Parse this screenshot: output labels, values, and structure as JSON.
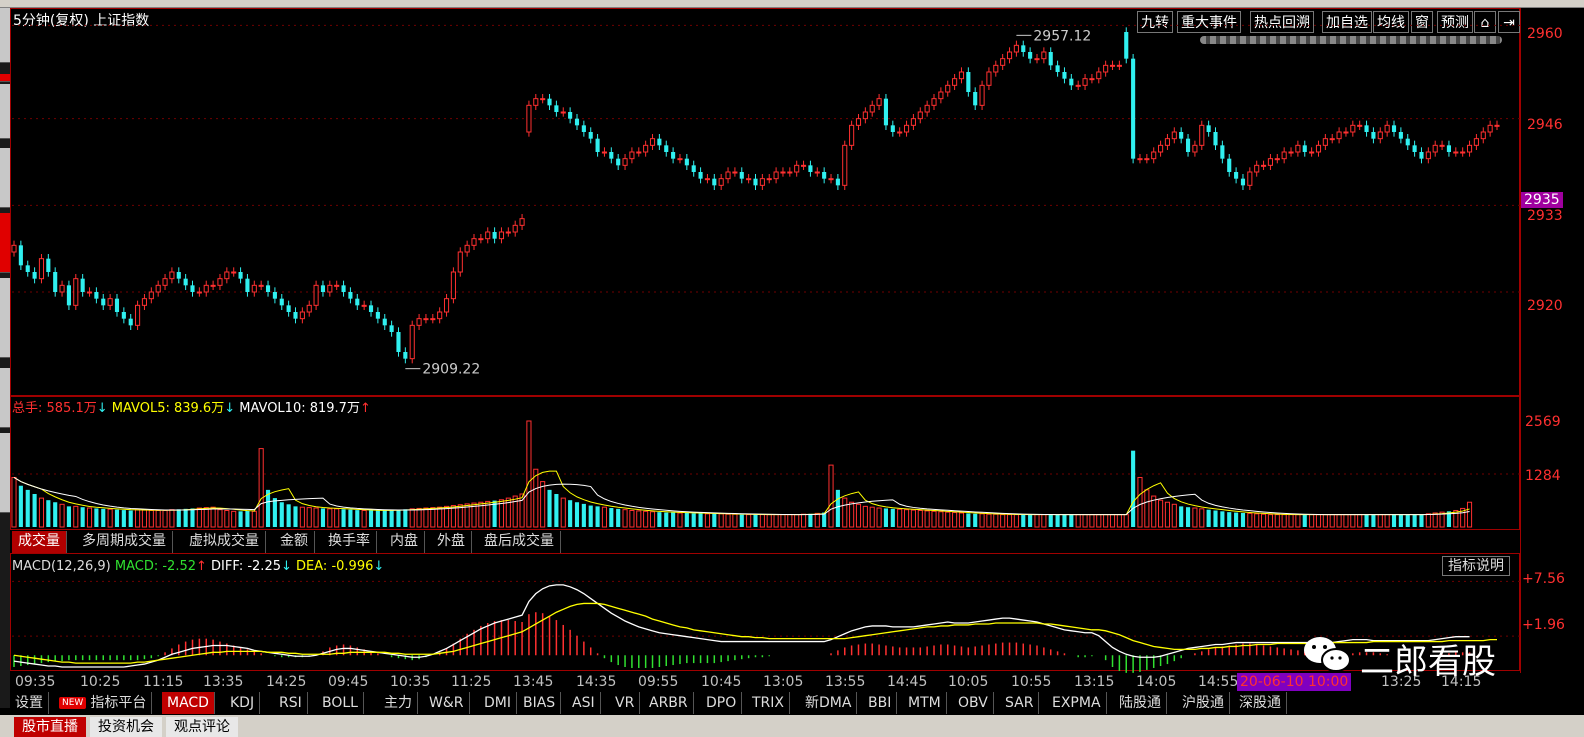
{
  "window": {
    "title": "5分钟(复权)",
    "index_name": "上证指数"
  },
  "toolbar": {
    "jiuzhuan": "九转",
    "major_events": "重大事件",
    "hotspot_trace": "热点回溯",
    "add_watch": "加自选",
    "ma_lines": "均线",
    "window": "窗",
    "forecast": "预测"
  },
  "colors": {
    "up": "#ff3030",
    "down": "#30f0f0",
    "ma5": "#ffff00",
    "ma10": "#ffffff",
    "axis": "#ff3030",
    "current_price_bg": "#a000a0"
  },
  "price_axis": {
    "labels": [
      "2960",
      "2946",
      "2933",
      "2920"
    ],
    "current": "2935"
  },
  "price_annotations": {
    "high": "2957.12",
    "low": "2909.22"
  },
  "volume_legend": {
    "total": "总手: 585.1万",
    "total_arrow": "↓",
    "mavol5": "MAVOL5: 839.6万",
    "mavol5_arrow": "↓",
    "mavol10": "MAVOL10: 819.7万",
    "mavol10_arrow": "↑"
  },
  "volume_axis": {
    "labels": [
      "2569",
      "1284"
    ]
  },
  "volume_tabs": [
    "成交量",
    "多周期成交量",
    "虚拟成交量",
    "金额",
    "换手率",
    "内盘",
    "外盘",
    "盘后成交量"
  ],
  "macd_legend": {
    "name": "MACD(12,26,9)",
    "macd": "MACD: -2.52",
    "macd_arrow": "↑",
    "diff": "DIFF: -2.25",
    "diff_arrow": "↓",
    "dea": "DEA: -0.996",
    "dea_arrow": "↓"
  },
  "macd_axis": {
    "labels": [
      "+7.56",
      "+1.96"
    ]
  },
  "indicator_help": "指标说明",
  "time_axis": [
    "09:35",
    "10:25",
    "11:15",
    "13:35",
    "14:25",
    "09:45",
    "10:35",
    "11:25",
    "13:45",
    "14:35",
    "09:55",
    "10:45",
    "13:05",
    "13:55",
    "14:45",
    "10:05",
    "10:55",
    "13:15",
    "14:05",
    "14:55",
    "13:25",
    "14:15"
  ],
  "time_cursor": "20-06-10 10:00",
  "indicator_tabs": {
    "settings": "设置",
    "new_badge": "NEW",
    "platform": "指标平台",
    "items": [
      "MACD",
      "KDJ",
      "RSI",
      "BOLL",
      "主力",
      "W&R",
      "DMI",
      "BIAS",
      "ASI",
      "VR",
      "ARBR",
      "DPO",
      "TRIX",
      "新DMA",
      "BBI",
      "MTM",
      "OBV",
      "SAR",
      "EXPMA",
      "陆股通",
      "沪股通",
      "深股通"
    ]
  },
  "bottom_tabs": [
    "股市直播",
    "投资机会",
    "观点评论"
  ],
  "watermark": "二郎看股",
  "chart_data": {
    "type": "candlestick",
    "ylim": [
      2905,
      2962
    ],
    "closes": [
      2927,
      2924,
      2923,
      2922,
      2925,
      2923,
      2920,
      2921,
      2918,
      2922,
      2920,
      2920,
      2919,
      2918,
      2919,
      2917,
      2916,
      2915,
      2918,
      2919,
      2920,
      2921,
      2922,
      2923,
      2922,
      2921,
      2920,
      2920,
      2921,
      2921,
      2922,
      2923,
      2923,
      2922,
      2920,
      2921,
      2921,
      2920,
      2919,
      2918,
      2917,
      2916,
      2917,
      2918,
      2921,
      2920,
      2921,
      2921,
      2920,
      2919,
      2918,
      2918,
      2917,
      2916,
      2915,
      2914,
      2911,
      2910,
      2915,
      2916,
      2916,
      2916,
      2917,
      2919,
      2923,
      2926,
      2927,
      2928,
      2928,
      2929,
      2928,
      2929,
      2929,
      2930,
      2931,
      2948,
      2949,
      2949,
      2948,
      2947,
      2947,
      2946,
      2945,
      2944,
      2943,
      2941,
      2941,
      2940,
      2939,
      2940,
      2941,
      2941,
      2942,
      2943,
      2942,
      2941,
      2940,
      2940,
      2939,
      2938,
      2937,
      2937,
      2936,
      2937,
      2938,
      2938,
      2937,
      2937,
      2936,
      2937,
      2937,
      2938,
      2938,
      2938,
      2939,
      2939,
      2938,
      2938,
      2937,
      2937,
      2936,
      2942,
      2945,
      2946,
      2947,
      2948,
      2949,
      2945,
      2944,
      2944,
      2945,
      2946,
      2947,
      2948,
      2949,
      2950,
      2951,
      2952,
      2953,
      2950,
      2948,
      2951,
      2953,
      2954,
      2955,
      2956,
      2957,
      2956,
      2955,
      2955,
      2956,
      2954,
      2953,
      2952,
      2951,
      2951,
      2952,
      2952,
      2953,
      2954,
      2954,
      2954,
      2955,
      2940,
      2940,
      2940,
      2941,
      2942,
      2943,
      2944,
      2943,
      2941,
      2942,
      2945,
      2944,
      2942,
      2940,
      2938,
      2937,
      2936,
      2938,
      2939,
      2939,
      2940,
      2940,
      2941,
      2941,
      2942,
      2941,
      2941,
      2942,
      2943,
      2943,
      2944,
      2944,
      2945,
      2945,
      2944,
      2943,
      2944,
      2945,
      2944,
      2943,
      2942,
      2941,
      2940,
      2941,
      2942,
      2942,
      2941,
      2941,
      2941,
      2942,
      2943,
      2944,
      2945,
      2945
    ],
    "volume_ylim": [
      0,
      2569
    ],
    "volumes": [
      1200,
      1000,
      900,
      800,
      700,
      650,
      600,
      550,
      500,
      500,
      480,
      460,
      450,
      440,
      430,
      420,
      410,
      400,
      420,
      410,
      400,
      400,
      400,
      420,
      430,
      440,
      450,
      460,
      470,
      480,
      420,
      400,
      380,
      380,
      400,
      380,
      1900,
      900,
      700,
      600,
      550,
      500,
      480,
      470,
      460,
      450,
      440,
      440,
      430,
      420,
      410,
      400,
      400,
      400,
      400,
      410,
      420,
      430,
      440,
      450,
      460,
      470,
      480,
      500,
      520,
      540,
      560,
      580,
      600,
      620,
      640,
      660,
      700,
      750,
      800,
      2569,
      1400,
      1100,
      900,
      800,
      700,
      650,
      600,
      560,
      520,
      500,
      480,
      460,
      440,
      420,
      400,
      390,
      380,
      370,
      360,
      350,
      350,
      340,
      340,
      330,
      330,
      320,
      320,
      320,
      310,
      310,
      300,
      300,
      300,
      300,
      300,
      300,
      300,
      300,
      300,
      310,
      320,
      330,
      350,
      1500,
      900,
      700,
      600,
      550,
      500,
      480,
      460,
      450,
      440,
      430,
      420,
      410,
      400,
      390,
      380,
      370,
      360,
      350,
      340,
      330,
      320,
      320,
      310,
      310,
      300,
      300,
      300,
      300,
      300,
      300,
      300,
      300,
      300,
      300,
      300,
      300,
      300,
      300,
      300,
      300,
      300,
      300,
      300,
      1850,
      1200,
      900,
      750,
      650,
      600,
      550,
      500,
      480,
      460,
      440,
      420,
      400,
      380,
      360,
      350,
      340,
      330,
      320,
      310,
      300,
      300,
      300,
      300,
      300,
      300,
      300,
      300,
      300,
      300,
      300,
      300,
      300,
      300,
      300,
      300,
      300,
      300,
      300,
      300,
      300,
      300,
      300,
      320,
      340,
      360,
      380,
      400,
      450,
      600
    ],
    "macd_ylim": [
      -1.2,
      7.9
    ],
    "macd_hist": [
      -1.2,
      -1.1,
      -1.0,
      -0.9,
      -0.8,
      -0.7,
      -0.6,
      -0.6,
      -0.5,
      -0.5,
      -0.5,
      -0.5,
      -0.5,
      -0.5,
      -0.5,
      -0.5,
      -0.5,
      -0.5,
      -0.5,
      -0.4,
      -0.3,
      -0.1,
      0.3,
      0.7,
      1.1,
      1.4,
      1.6,
      1.7,
      1.7,
      1.6,
      1.4,
      1.2,
      1.0,
      0.8,
      0.6,
      0.4,
      0.2,
      0,
      -0.1,
      -0.2,
      -0.2,
      -0.2,
      -0.2,
      -0.1,
      0,
      0.4,
      0.8,
      1.0,
      1.1,
      1.0,
      0.8,
      0.6,
      0.4,
      0.2,
      0,
      -0.2,
      -0.3,
      -0.4,
      -0.5,
      -0.4,
      -0.2,
      0,
      0.3,
      0.7,
      1.2,
      1.7,
      2.2,
      2.6,
      3.0,
      3.3,
      3.5,
      3.6,
      3.6,
      3.5,
      3.4,
      4.2,
      4.4,
      4.3,
      4.0,
      3.6,
      3.1,
      2.6,
      2.0,
      1.4,
      0.8,
      0.2,
      -0.3,
      -0.7,
      -1.0,
      -1.2,
      -1.3,
      -1.3,
      -1.3,
      -1.3,
      -1.2,
      -1.1,
      -1.0,
      -0.9,
      -0.8,
      -0.8,
      -0.8,
      -0.8,
      -0.8,
      -0.7,
      -0.6,
      -0.5,
      -0.4,
      -0.3,
      -0.2,
      -0.2,
      -0.1,
      0,
      0,
      0,
      0,
      0,
      0,
      0,
      0,
      0.2,
      0.5,
      0.8,
      1.0,
      1.1,
      1.2,
      1.2,
      1.1,
      1.0,
      0.9,
      0.8,
      0.8,
      0.8,
      0.8,
      0.9,
      1.0,
      1.1,
      1.1,
      1.0,
      0.9,
      0.8,
      0.9,
      1.0,
      1.1,
      1.2,
      1.3,
      1.3,
      1.3,
      1.2,
      1.1,
      1.0,
      0.8,
      0.6,
      0.4,
      0.2,
      0,
      -0.2,
      -0.2,
      -0.1,
      0,
      -0.5,
      -1.2,
      -1.6,
      -1.8,
      -1.8,
      -1.7,
      -1.5,
      -1.3,
      -1.1,
      -0.9,
      -0.6,
      -0.3,
      0,
      0.2,
      0.4,
      0.6,
      0.8,
      0.9,
      1.0,
      1.1,
      1.2,
      1.2,
      1.1,
      1.0,
      0.9,
      0.8,
      0.7,
      0.6,
      0.5,
      0.4,
      0.3,
      0.2,
      0.1,
      0,
      0,
      0.1,
      0.2,
      0.3,
      0.3,
      0.3,
      0.2,
      0.1,
      0,
      0,
      0,
      0,
      0,
      0,
      0,
      0.1,
      0.2,
      0.3,
      0.3,
      0.3
    ],
    "diff": [
      -0.6,
      -0.7,
      -0.8,
      -0.9,
      -1.0,
      -1.1,
      -1.1,
      -1.2,
      -1.2,
      -1.2,
      -1.2,
      -1.2,
      -1.2,
      -1.2,
      -1.2,
      -1.2,
      -1.2,
      -1.1,
      -1.0,
      -0.9,
      -0.7,
      -0.5,
      -0.2,
      0.1,
      0.3,
      0.5,
      0.7,
      0.8,
      0.9,
      1.0,
      1.0,
      1.0,
      0.9,
      0.8,
      0.7,
      0.5,
      0.4,
      0.3,
      0.2,
      0.1,
      0,
      -0.1,
      -0.1,
      -0.1,
      0,
      0.2,
      0.4,
      0.6,
      0.7,
      0.7,
      0.6,
      0.5,
      0.4,
      0.3,
      0.2,
      0.1,
      0,
      -0.1,
      -0.2,
      -0.2,
      -0.1,
      0.1,
      0.4,
      0.7,
      1.1,
      1.5,
      1.9,
      2.3,
      2.7,
      3.0,
      3.3,
      3.5,
      3.7,
      3.9,
      4.1,
      5.5,
      6.3,
      6.8,
      7.1,
      7.2,
      7.2,
      7.0,
      6.7,
      6.3,
      5.8,
      5.3,
      4.8,
      4.3,
      3.9,
      3.5,
      3.2,
      2.9,
      2.7,
      2.5,
      2.3,
      2.2,
      2.1,
      2.0,
      1.9,
      1.8,
      1.7,
      1.6,
      1.5,
      1.4,
      1.4,
      1.4,
      1.4,
      1.4,
      1.4,
      1.4,
      1.4,
      1.4,
      1.4,
      1.4,
      1.4,
      1.4,
      1.4,
      1.4,
      1.4,
      1.6,
      1.9,
      2.2,
      2.5,
      2.7,
      2.9,
      3.0,
      3.0,
      3.0,
      2.9,
      2.9,
      2.9,
      2.9,
      3.0,
      3.1,
      3.2,
      3.3,
      3.4,
      3.3,
      3.3,
      3.3,
      3.4,
      3.5,
      3.6,
      3.7,
      3.8,
      3.8,
      3.7,
      3.6,
      3.5,
      3.4,
      3.2,
      3.0,
      2.8,
      2.6,
      2.5,
      2.4,
      2.3,
      2.3,
      2.0,
      1.4,
      0.8,
      0.4,
      0.1,
      -0.1,
      -0.2,
      -0.2,
      -0.2,
      -0.1,
      0.1,
      0.3,
      0.5,
      0.7,
      0.8,
      0.9,
      1.0,
      1.1,
      1.1,
      1.2,
      1.3,
      1.3,
      1.3,
      1.3,
      1.3,
      1.3,
      1.3,
      1.3,
      1.3,
      1.3,
      1.3,
      1.3,
      1.3,
      1.3,
      1.3,
      1.4,
      1.5,
      1.6,
      1.6,
      1.6,
      1.5,
      1.5,
      1.5,
      1.5,
      1.5,
      1.5,
      1.5,
      1.5,
      1.5,
      1.6,
      1.7,
      1.8,
      1.9,
      1.9,
      1.9
    ],
    "dea": [
      0.0,
      -0.1,
      -0.2,
      -0.3,
      -0.4,
      -0.5,
      -0.6,
      -0.7,
      -0.7,
      -0.8,
      -0.8,
      -0.8,
      -0.8,
      -0.8,
      -0.8,
      -0.8,
      -0.8,
      -0.8,
      -0.7,
      -0.7,
      -0.6,
      -0.5,
      -0.4,
      -0.3,
      -0.2,
      -0.1,
      0,
      0.1,
      0.2,
      0.3,
      0.3,
      0.4,
      0.4,
      0.4,
      0.4,
      0.4,
      0.4,
      0.3,
      0.3,
      0.3,
      0.2,
      0.2,
      0.1,
      0.1,
      0.1,
      0.1,
      0.1,
      0.2,
      0.2,
      0.3,
      0.3,
      0.3,
      0.3,
      0.3,
      0.3,
      0.2,
      0.2,
      0.1,
      0.1,
      0.1,
      0.1,
      0.1,
      0.2,
      0.3,
      0.4,
      0.6,
      0.8,
      1.0,
      1.2,
      1.4,
      1.6,
      1.8,
      2.0,
      2.2,
      2.4,
      2.8,
      3.2,
      3.6,
      4.0,
      4.4,
      4.7,
      5.0,
      5.2,
      5.3,
      5.3,
      5.3,
      5.2,
      5.0,
      4.8,
      4.6,
      4.4,
      4.2,
      4.0,
      3.7,
      3.5,
      3.3,
      3.1,
      2.9,
      2.8,
      2.6,
      2.5,
      2.4,
      2.3,
      2.2,
      2.1,
      2.0,
      1.9,
      1.9,
      1.8,
      1.8,
      1.7,
      1.7,
      1.7,
      1.7,
      1.7,
      1.7,
      1.7,
      1.7,
      1.7,
      1.7,
      1.7,
      1.7,
      1.8,
      1.9,
      2.0,
      2.1,
      2.2,
      2.3,
      2.4,
      2.5,
      2.6,
      2.7,
      2.8,
      2.9,
      2.9,
      3.0,
      3.0,
      3.1,
      3.1,
      3.1,
      3.2,
      3.2,
      3.2,
      3.3,
      3.3,
      3.3,
      3.3,
      3.3,
      3.3,
      3.3,
      3.2,
      3.2,
      3.1,
      3.0,
      2.9,
      2.8,
      2.7,
      2.6,
      2.6,
      2.5,
      2.3,
      2.1,
      1.8,
      1.5,
      1.3,
      1.1,
      0.9,
      0.8,
      0.7,
      0.6,
      0.6,
      0.6,
      0.6,
      0.7,
      0.7,
      0.8,
      0.8,
      0.9,
      0.9,
      1.0,
      1.0,
      1.1,
      1.1,
      1.1,
      1.2,
      1.2,
      1.2,
      1.2,
      1.2,
      1.2,
      1.3,
      1.3,
      1.3,
      1.3,
      1.3,
      1.3,
      1.3,
      1.3,
      1.4,
      1.4,
      1.4,
      1.4,
      1.4,
      1.4,
      1.4,
      1.4,
      1.4,
      1.4,
      1.4,
      1.5,
      1.5,
      1.5,
      1.5,
      1.5,
      1.5,
      1.6,
      1.6
    ]
  }
}
